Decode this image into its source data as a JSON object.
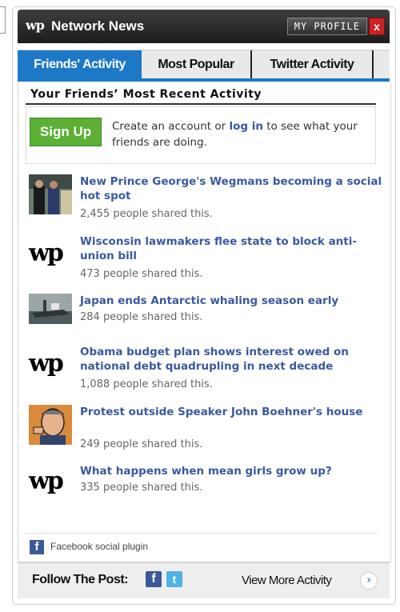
{
  "header": {
    "logo": "wp",
    "title": "Network News",
    "profile_label": "MY PROFILE",
    "close_label": "x"
  },
  "tabs": [
    {
      "label": "Friends' Activity",
      "active": true
    },
    {
      "label": "Most Popular",
      "active": false
    },
    {
      "label": "Twitter Activity",
      "active": false
    }
  ],
  "section_title": "Your Friends’ Most Recent Activity",
  "signup": {
    "button_label": "Sign Up",
    "text_before": "Create an account or ",
    "link_text": "log in",
    "text_after": " to see what your friends are doing."
  },
  "items": [
    {
      "title": "New Prince George's Wegmans becoming a social hot spot",
      "count": "2,455 people shared this.",
      "thumb": "photo-people"
    },
    {
      "title": "Wisconsin lawmakers flee state to block anti-union bill",
      "count": "473 people shared this.",
      "thumb": "wp-logo"
    },
    {
      "title": "Japan ends Antarctic whaling season early",
      "count": "284 people shared this.",
      "thumb": "photo-ship"
    },
    {
      "title": "Obama budget plan shows interest owed on national debt quadrupling in next decade",
      "count": "1,088 people shared this.",
      "thumb": "wp-logo"
    },
    {
      "title": "Protest outside Speaker John Boehner's house",
      "count": "249 people shared this.",
      "thumb": "illustration-portrait"
    },
    {
      "title": "What happens when mean girls grow up?",
      "count": "335 people shared this.",
      "thumb": "wp-logo"
    }
  ],
  "plugin_label": "Facebook social plugin",
  "footer": {
    "follow_label": "Follow The Post:",
    "facebook_glyph": "f",
    "twitter_glyph": "t",
    "view_more_label": "View More Activity",
    "arrow_glyph": "›"
  },
  "colors": {
    "accent": "#1d78c8",
    "link": "#3b59a0",
    "signup": "#5bb035",
    "close": "#cc2222"
  }
}
